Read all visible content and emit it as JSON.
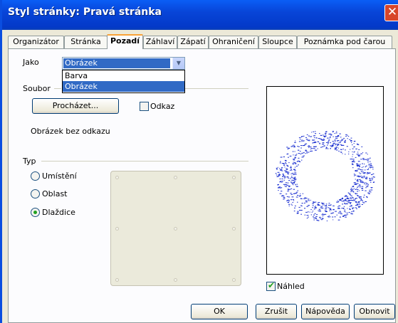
{
  "window": {
    "title": "Styl stránky: Pravá stránka",
    "close_label": "✕"
  },
  "tabs": [
    {
      "label": "Organizátor"
    },
    {
      "label": "Stránka"
    },
    {
      "label": "Pozadí"
    },
    {
      "label": "Záhlaví"
    },
    {
      "label": "Zápatí"
    },
    {
      "label": "Ohraničení"
    },
    {
      "label": "Sloupce"
    },
    {
      "label": "Poznámka pod čarou"
    }
  ],
  "active_tab": "Pozadí",
  "as_field": {
    "label": "Jako",
    "value": "Obrázek",
    "options": [
      "Barva",
      "Obrázek"
    ],
    "selected_option": "Obrázek"
  },
  "file_group": {
    "label": "Soubor",
    "browse_button": "Procházet...",
    "link_checkbox": {
      "label": "Odkaz",
      "checked": false
    },
    "status": "Obrázek bez odkazu"
  },
  "type_group": {
    "label": "Typ",
    "options": [
      {
        "label": "Umístění",
        "selected": false
      },
      {
        "label": "Oblast",
        "selected": false
      },
      {
        "label": "Dlaždice",
        "selected": true
      }
    ]
  },
  "preview_checkbox": {
    "label": "Náhled",
    "checked": true
  },
  "footer": {
    "ok": "OK",
    "cancel": "Zrušit",
    "help": "Nápověda",
    "reset": "Obnovit"
  },
  "colors": {
    "title_bar": "#0845d8",
    "selection": "#316ac5",
    "preview_pattern": "#1a2fd0"
  }
}
